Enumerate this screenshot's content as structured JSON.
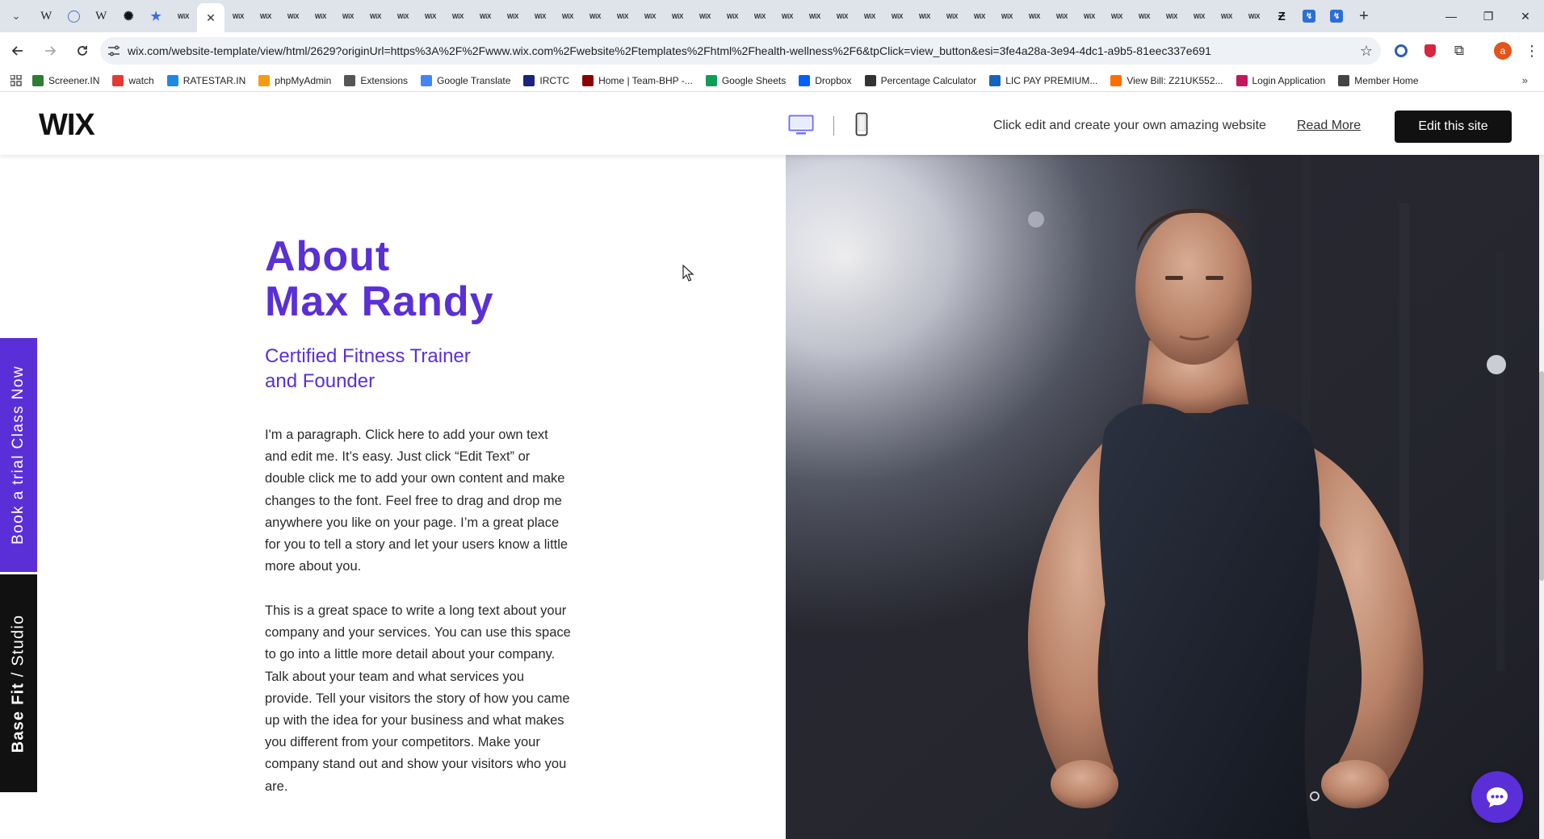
{
  "browser": {
    "tabs": [
      {
        "icon": "menu",
        "label": ""
      },
      {
        "icon": "wikipedia",
        "label": "W"
      },
      {
        "icon": "globe",
        "label": ""
      },
      {
        "icon": "wikipedia",
        "label": "W"
      },
      {
        "icon": "openai",
        "label": ""
      },
      {
        "icon": "star",
        "label": "★"
      },
      {
        "icon": "wix",
        "label": "WiX"
      }
    ],
    "wix_tab_label": "WiX",
    "active_close": "✕",
    "new_tab": "+",
    "window_controls": {
      "minimize": "—",
      "restore": "❐",
      "close": "✕"
    },
    "url": "wix.com/website-template/view/html/2629?originUrl=https%3A%2F%2Fwww.wix.com%2Fwebsite%2Ftemplates%2Fhtml%2Fhealth-wellness%2F6&tpClick=view_button&esi=3fe4a28a-3e94-4dc1-a9b5-81eec337e691",
    "profile_initial": "a",
    "bookmarks": [
      {
        "label": "Screener.IN",
        "color": "#2e7d32"
      },
      {
        "label": "watch",
        "color": "#e53935"
      },
      {
        "label": "RATESTAR.IN",
        "color": "#1e88e5"
      },
      {
        "label": "phpMyAdmin",
        "color": "#f39c12"
      },
      {
        "label": "Extensions",
        "color": "#555555"
      },
      {
        "label": "Google Translate",
        "color": "#4285f4"
      },
      {
        "label": "IRCTC",
        "color": "#1a237e"
      },
      {
        "label": "Home | Team-BHP -...",
        "color": "#8b0000"
      },
      {
        "label": "Google Sheets",
        "color": "#0f9d58"
      },
      {
        "label": "Dropbox",
        "color": "#0061ff"
      },
      {
        "label": "Percentage Calculator",
        "color": "#333333"
      },
      {
        "label": "LIC PAY PREMIUM...",
        "color": "#1565c0"
      },
      {
        "label": "View Bill: Z21UK552...",
        "color": "#ff6f00"
      },
      {
        "label": "Login Application",
        "color": "#c2185b"
      },
      {
        "label": "Member Home",
        "color": "#444444"
      }
    ],
    "bookmarks_more": "»"
  },
  "wix_bar": {
    "logo": "WIX",
    "promo_text": "Click edit and create your own amazing website",
    "read_more": "Read More",
    "edit_button": "Edit this site"
  },
  "page": {
    "title_line1": "About",
    "title_line2": "Max Randy",
    "subtitle_line1": "Certified Fitness Trainer",
    "subtitle_line2": "and Founder",
    "paragraph1": "I'm a paragraph. Click here to add your own text and edit me. It’s easy. Just click “Edit Text” or double click me to add your own content and make changes to the font. Feel free to drag and drop me anywhere you like on your page. I’m a great place for you to tell a story and let your users know a little more about you.",
    "paragraph2": "This is a great space to write a long text about your company and your services. You can use this space to go into a little more detail about your company. Talk about your team and what services you provide. Tell your visitors the story of how you came up with the idea for your business and what makes you different from your competitors. Make your company stand out and show your visitors who you are.",
    "side_book": "Book a trial Class Now",
    "side_brand_bold": "Base Fit",
    "side_brand_sep": " / ",
    "side_brand_rest": "Studio"
  },
  "colors": {
    "accent_purple": "#5a2fd6",
    "button_black": "#111111"
  }
}
